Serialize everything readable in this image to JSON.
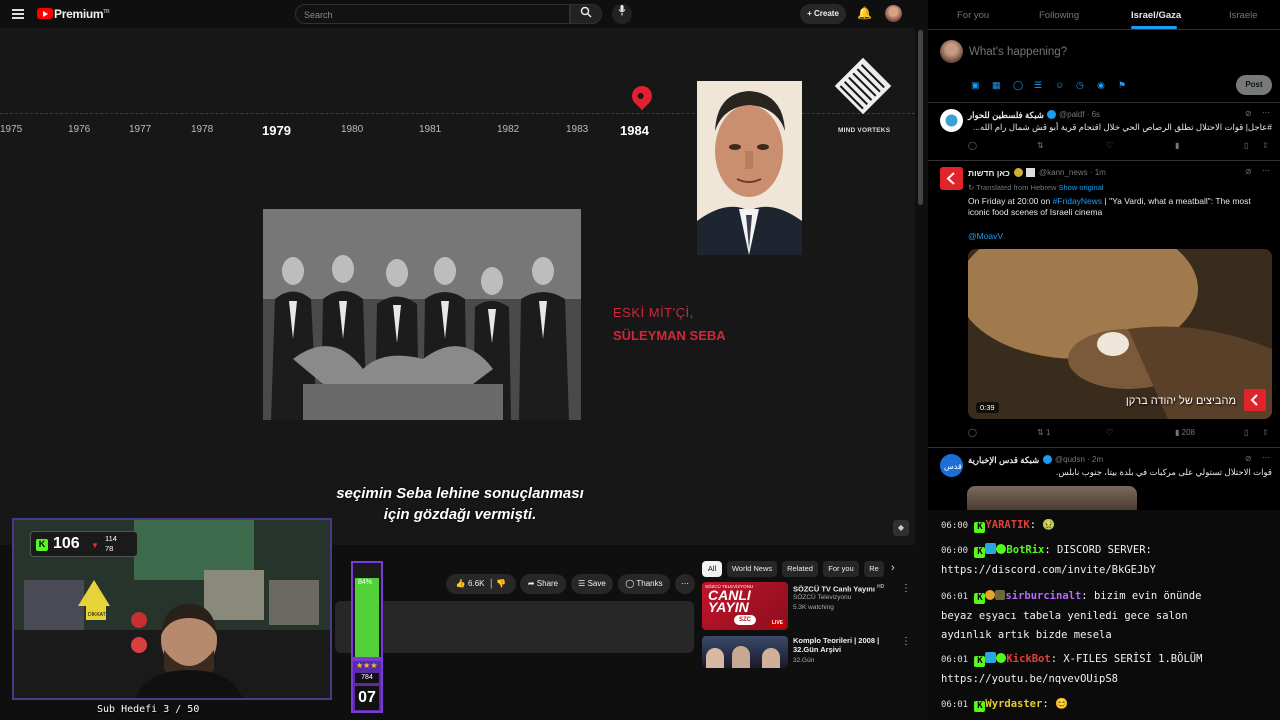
{
  "youtube": {
    "brand": "Premium",
    "brand_sup": "TR",
    "search_placeholder": "Search",
    "create_label": "Create"
  },
  "video": {
    "timeline_years": [
      "1975",
      "1976",
      "1977",
      "1978",
      "1979",
      "1980",
      "1981",
      "1982",
      "1983",
      "1984"
    ],
    "highlight_years": [
      "1979",
      "1984"
    ],
    "channel_logo_text": "MIND VORTEKS",
    "caption_line1": "ESKİ MİT'Çİ,",
    "caption_line2": "SÜLEYMAN SEBA",
    "subtitle_line1": "seçimin Seba lehine sonuçlanması",
    "subtitle_line2": "için gözdağı vermişti."
  },
  "actions": {
    "likes": "6.6K",
    "share": "Share",
    "save": "Save",
    "thanks": "Thanks"
  },
  "chips": [
    "All",
    "World News",
    "Related",
    "For you",
    "Re"
  ],
  "recommendations": [
    {
      "title": "SÖZCÜ TV Canlı Yayını",
      "hd": "HD",
      "channel": "SÖZCÜ Televizyonu",
      "meta": "5.3K watching",
      "badge": "LIVE",
      "thumb_text1": "CANLI",
      "thumb_text2": "YAYIN",
      "thumb_brand": "SZC",
      "thumb_header": "SÖZCÜ TELEVİZYONU"
    },
    {
      "title": "Komplo Teorileri | 2008 | 32.Gün Arşivi",
      "channel": "32.Gün"
    }
  ],
  "stream": {
    "kick_viewers": "106",
    "stat_a": "114",
    "stat_b": "78",
    "sign_text": "DİKKAT",
    "meter_percent": "84%",
    "meter_fraction": 0.84,
    "meter_count": "784",
    "meter_level": "07",
    "sub_goal": "Sub Hedefi 3 / 50"
  },
  "twitter": {
    "tabs": [
      "For you",
      "Following",
      "Israel/Gaza",
      "Israele"
    ],
    "selected_tab": "Israel/Gaza",
    "compose_placeholder": "What's happening?",
    "post_label": "Post",
    "tweets": [
      {
        "name": "شبكة فلسطين للحوار",
        "handle": "@paldf · 6s",
        "text": "#عاجل| قوات الاحتلال تطلق الرصاص الحي خلال اقتحام قرية أبو قش شمال رام الله..."
      },
      {
        "name": "כאן חדשות",
        "handle": "@kann_news · 1m",
        "translated": "Translated from Hebrew",
        "show_original": "Show original",
        "text_pre": "On Friday at 20:00 on ",
        "hashtag": "#FridayNews",
        "text_post": " | \"Ya Vardi, what a meatball\": The most iconic food scenes of Israeli cinema",
        "mention": "@MoavV",
        "media_caption": "מהביצים של יהודה ברקן",
        "duration": "0:39",
        "retweets": "1",
        "views": "208"
      },
      {
        "name": "شبكة قدس الإخبارية",
        "handle": "@qudsn · 2m",
        "text": "قوات الاحتلال تستولي على مركبات في بلدة بيتا، جنوب نابلس."
      }
    ]
  },
  "chat": [
    {
      "time": "06:00",
      "user": "YARATIK",
      "user_color": "#e0403a",
      "sep": ":",
      "msg": "🤢"
    },
    {
      "time": "06:00",
      "user": "BotRix",
      "user_color": "#53fc18",
      "sep": ":",
      "msg": "DISCORD SERVER:",
      "msg2": "https://discord.com/invite/BkGEJbY"
    },
    {
      "time": "06:01",
      "user": "sirburcinalt",
      "user_color": "#b36bff",
      "sep": ":",
      "msg": "bizim evin önünde",
      "msg2": "beyaz eşyacı tabela yeniledi gece salon",
      "msg3": "aydınlık artık bizde mesela"
    },
    {
      "time": "06:01",
      "user": "KickBot",
      "user_color": "#e0403a",
      "sep": ":",
      "msg": "X-FILES SERİSİ 1.BÖLÜM",
      "msg2": "https://youtu.be/nqvevOUipS8"
    },
    {
      "time": "06:01",
      "user": "Wyrdaster",
      "user_color": "#e8c92a",
      "sep": ":",
      "msg": "😊"
    }
  ],
  "colors": {
    "accent_red": "#d02838",
    "twitter_blue": "#1d9bf0",
    "kick_green": "#53fc18"
  }
}
